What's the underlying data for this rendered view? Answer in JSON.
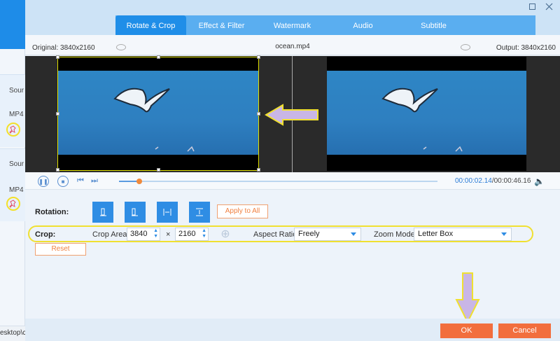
{
  "bg_app": {
    "items": [
      {
        "source_label": "Sour",
        "format_label": "MP4"
      },
      {
        "source_label": "Sour",
        "format_label": "MP4"
      }
    ],
    "status_text": "esktop\\c"
  },
  "window": {
    "restore_icon": "restore-icon",
    "close_icon": "close-icon"
  },
  "tabs": [
    {
      "label": "Rotate & Crop",
      "active": true
    },
    {
      "label": "Effect & Filter",
      "active": false
    },
    {
      "label": "Watermark",
      "active": false
    },
    {
      "label": "Audio",
      "active": false
    },
    {
      "label": "Subtitle",
      "active": false
    }
  ],
  "info": {
    "original": "Original: 3840x2160",
    "filename": "ocean.mp4",
    "output": "Output: 3840x2160"
  },
  "playback": {
    "current_time": "00:00:02.14",
    "duration": "/00:00:46.16",
    "progress": 0.046
  },
  "rotation": {
    "label": "Rotation:",
    "buttons": [
      "rotate-left-icon",
      "rotate-right-icon",
      "flip-horizontal-icon",
      "flip-vertical-icon"
    ],
    "apply_label": "Apply to All"
  },
  "crop": {
    "label": "Crop:",
    "area_label": "Crop Area:",
    "width": "3840",
    "times": "×",
    "height": "2160",
    "aspect_label": "Aspect Ratio:",
    "aspect_value": "Freely",
    "zoom_label": "Zoom Mode:",
    "zoom_value": "Letter Box",
    "reset_label": "Reset"
  },
  "footer": {
    "ok_label": "OK",
    "cancel_label": "Cancel"
  },
  "colors": {
    "accent": "#1f8ee8",
    "ok": "#f26e3d",
    "highlight": "#f0e030"
  }
}
